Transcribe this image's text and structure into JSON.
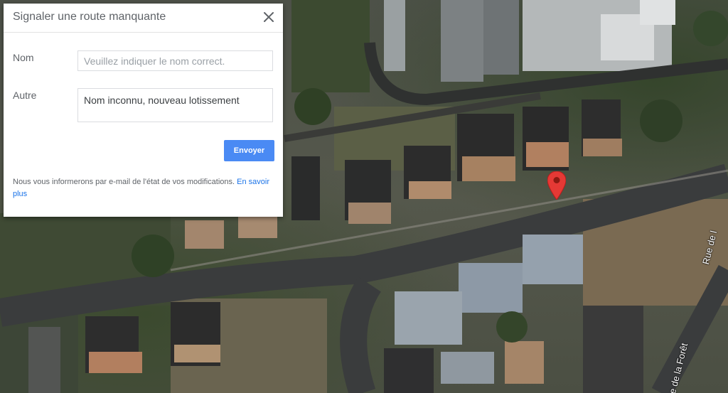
{
  "dialog": {
    "title": "Signaler une route manquante",
    "close_icon": "close-icon",
    "name_label": "Nom",
    "name_placeholder": "Veuillez indiquer le nom correct.",
    "name_value": "",
    "other_label": "Autre",
    "other_value": "Nom inconnu, nouveau lotissement",
    "send_label": "Envoyer",
    "notice_text": "Nous vous informerons par e-mail de l'état de vos modifications.",
    "learn_more_label": "En savoir plus"
  },
  "map": {
    "street_label_1": "Rue de l",
    "street_label_2": "e de la Forêt",
    "pin_icon": "map-pin-icon",
    "pin_color": "#e53935"
  },
  "colors": {
    "accent": "#4a8af4",
    "link": "#1a73e8"
  }
}
